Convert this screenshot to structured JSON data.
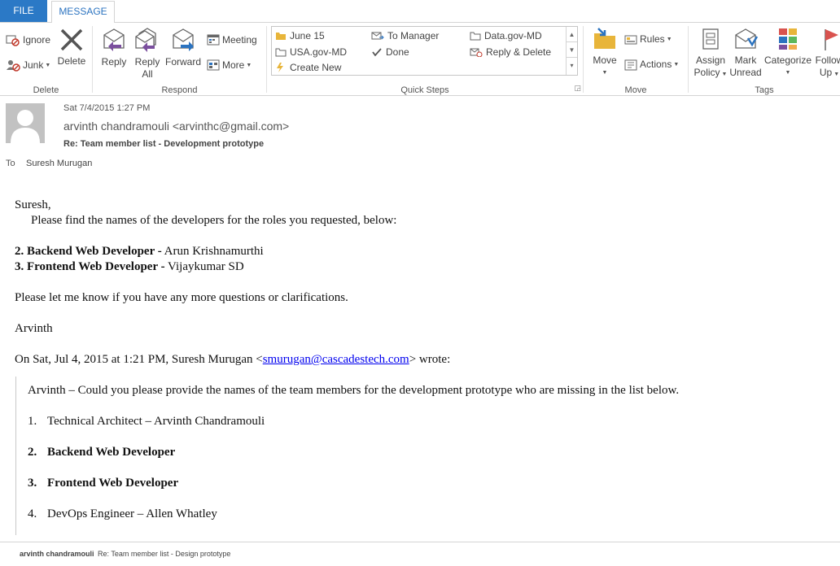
{
  "tabs": {
    "file": "FILE",
    "message": "MESSAGE"
  },
  "ribbon": {
    "delete_group": {
      "label": "Delete",
      "ignore": "Ignore",
      "junk": "Junk",
      "delete": "Delete"
    },
    "respond_group": {
      "label": "Respond",
      "reply": "Reply",
      "reply_all_line1": "Reply",
      "reply_all_line2": "All",
      "forward": "Forward",
      "meeting": "Meeting",
      "more": "More"
    },
    "quick_steps": {
      "label": "Quick Steps",
      "items": [
        "June 15",
        "USA.gov-MD",
        "Create New",
        "To Manager",
        "Done",
        "Data.gov-MD",
        "Reply & Delete"
      ]
    },
    "move_group": {
      "label": "Move",
      "move": "Move",
      "rules": "Rules",
      "actions": "Actions"
    },
    "tags_group": {
      "label": "Tags",
      "assign_line1": "Assign",
      "assign_line2": "Policy",
      "mark_line1": "Mark",
      "mark_line2": "Unread",
      "categorize": "Categorize",
      "follow_line1": "Follow",
      "follow_line2": "Up"
    }
  },
  "header": {
    "date": "Sat 7/4/2015 1:27 PM",
    "from": "arvinth chandramouli <arvinthc@gmail.com>",
    "subject": "Re: Team member list - Development prototype",
    "to_label": "To",
    "to": "Suresh Murugan"
  },
  "body": {
    "greeting": "Suresh,",
    "intro": "Please find the names of the developers for the roles you requested, below:",
    "role2_title": "2. Backend Web Developer -",
    "role2_name": " Arun Krishnamurthi",
    "role3_title": "3. Frontend Web Developer -",
    "role3_name": " Vijaykumar SD",
    "closing": "Please let me know if you have any more questions or clarifications.",
    "signature": "Arvinth",
    "wrote_prefix": "On Sat, Jul 4, 2015 at 1:21 PM, Suresh Murugan <",
    "wrote_email": "smurugan@cascadestech.com",
    "wrote_suffix": "> wrote:"
  },
  "quote": {
    "request": "Arvinth – Could you please provide the names of the team members for the development prototype who are missing in the list below.",
    "items": [
      {
        "num": "1.",
        "text": "Technical Architect – Arvinth Chandramouli",
        "bold": false
      },
      {
        "num": "2.",
        "text": "Backend Web Developer",
        "bold": true
      },
      {
        "num": "3.",
        "text": "Frontend Web Developer",
        "bold": true
      },
      {
        "num": "4.",
        "text": "DevOps Engineer – Allen Whatley",
        "bold": false
      }
    ]
  },
  "footer": {
    "from": "arvinth chandramouli",
    "subject": "Re: Team member list - Design prototype"
  },
  "colors": {
    "file_tab": "#2b79c6",
    "accent": "#2b73c0",
    "link": "#0000ee"
  }
}
